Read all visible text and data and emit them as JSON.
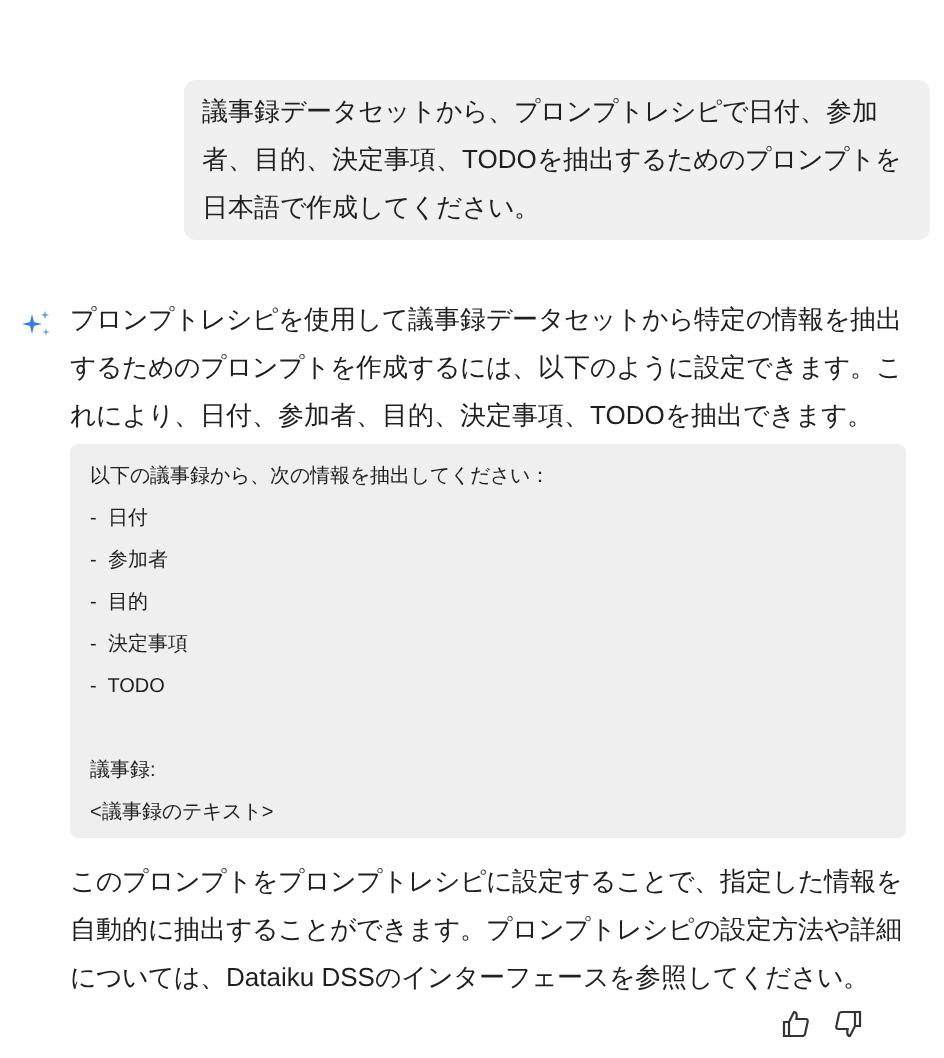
{
  "user_message": "議事録データセットから、プロンプトレシピで日付、参加者、目的、決定事項、TODOを抽出するためのプロンプトを日本語で作成してください。",
  "assistant": {
    "intro": "プロンプトレシピを使用して議事録データセットから特定の情報を抽出するためのプロンプトを作成するには、以下のように設定できます。これにより、日付、参加者、目的、決定事項、TODOを抽出できます。",
    "code_block": [
      [
        "以下の議事録から、次の情報を抽出してください：",
        "-  日付",
        "-  参加者",
        "-  目的",
        "-  決定事項",
        "-  TODO"
      ],
      [
        "議事録:",
        "<議事録のテキスト>"
      ]
    ],
    "outro": "このプロンプトをプロンプトレシピに設定することで、指定した情報を自動的に抽出することができます。プロンプトレシピの設定方法や詳細については、Dataiku DSSのインターフェースを参照してください。"
  }
}
